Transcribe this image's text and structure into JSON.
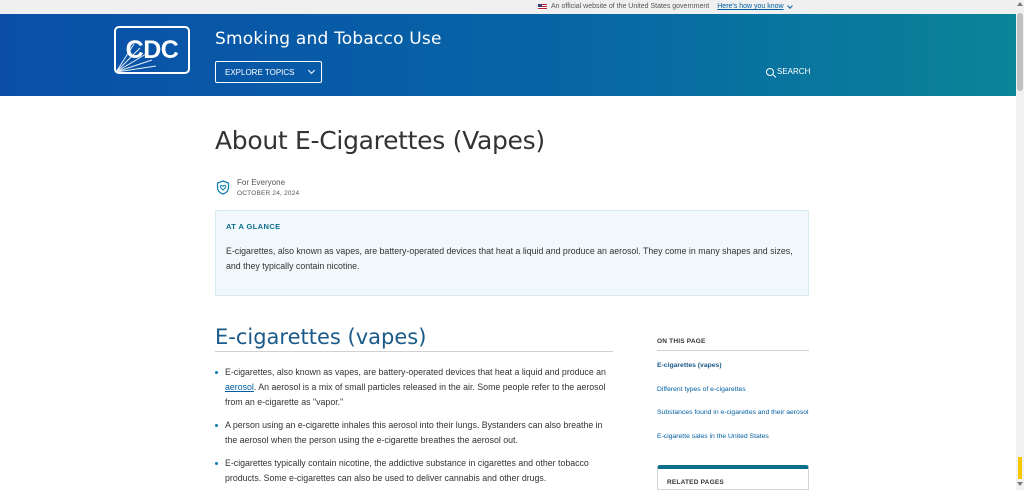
{
  "gov_banner": {
    "text": "An official website of the United States government",
    "link": "Here's how you know"
  },
  "header": {
    "logo_text": "CDC",
    "site_title": "Smoking and Tobacco Use",
    "explore_label": "EXPLORE TOPICS",
    "search_label": "SEARCH"
  },
  "page": {
    "title": "About E-Cigarettes (Vapes)",
    "audience": "For Everyone",
    "date": "OCTOBER 24, 2024"
  },
  "glance": {
    "label": "AT A GLANCE",
    "text": "E-cigarettes, also known as vapes, are battery-operated devices that heat a liquid and produce an aerosol. They come in many shapes and sizes, and they typically contain nicotine."
  },
  "section": {
    "heading": "E-cigarettes (vapes)",
    "bullets": [
      {
        "before_link": "E-cigarettes, also known as vapes, are battery-operated devices that heat a liquid and produce an ",
        "link": "aerosol",
        "after_link": ". An aerosol is a mix of small particles released in the air. Some people refer to the aerosol from an e-cigarette as \"vapor.\""
      },
      {
        "text": "A person using an e-cigarette inhales this aerosol into their lungs. Bystanders can also breathe in the aerosol when the person using the e-cigarette breathes the aerosol out."
      },
      {
        "text": "E-cigarettes typically contain nicotine, the addictive substance in cigarettes and other tobacco products. Some e-cigarettes can also be used to deliver cannabis and other drugs."
      }
    ]
  },
  "on_this_page": {
    "label": "ON THIS PAGE",
    "items": [
      "E-cigarettes (vapes)",
      "Different types of e-cigarettes",
      "Substances found in e-cigarettes and their aerosol",
      "E-cigarette sales in the United States"
    ]
  },
  "related_pages": {
    "label": "RELATED PAGES"
  },
  "colors": {
    "header_start": "#0a4ea8",
    "header_end": "#0a8497",
    "link": "#005ea2",
    "heading_blue": "#1a5a8a",
    "glance_bg": "#f1f8fb"
  }
}
